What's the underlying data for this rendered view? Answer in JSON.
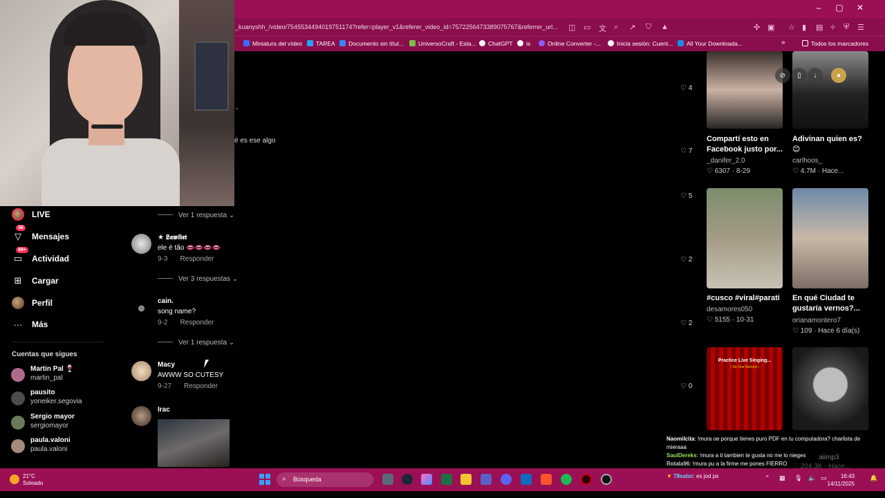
{
  "browser": {
    "url": "_kuanyshh_/video/7545534494019751174?refer=player_v1&referer_video_id=7572256473389075767&referrer_url...",
    "window_controls": [
      "–",
      "▢",
      "✕"
    ],
    "bookmarks": [
      {
        "label": "Miniatura del vídeo",
        "color": "#3b6cff"
      },
      {
        "label": "TAREA",
        "color": "#2ca0ff"
      },
      {
        "label": "Documento sin títul...",
        "color": "#3b82f6"
      },
      {
        "label": "UniversoCraft - Esta...",
        "color": "#7bc043"
      },
      {
        "label": "ChatGPT",
        "color": "#ffffff"
      },
      {
        "label": "is",
        "color": "#ffffff"
      },
      {
        "label": "Online Converter -...",
        "color": "#8b5cf6"
      },
      {
        "label": "Inicia sesión: Cuent...",
        "color": "#ffffff"
      },
      {
        "label": "All Your Downloada...",
        "color": "#1e88e5"
      }
    ],
    "bookmarks_more": "»",
    "all_bookmarks": "Todos los marcadores"
  },
  "nav": [
    {
      "label": "LIVE",
      "icon": "live-avatar-icon",
      "badge": ""
    },
    {
      "label": "Mensajes",
      "icon": "send-icon",
      "badge": "36"
    },
    {
      "label": "Actividad",
      "icon": "inbox-icon",
      "badge": "99+"
    },
    {
      "label": "Cargar",
      "icon": "plus-square-icon",
      "badge": ""
    },
    {
      "label": "Perfil",
      "icon": "profile-avatar-icon",
      "badge": ""
    },
    {
      "label": "Más",
      "icon": "more-icon",
      "badge": ""
    }
  ],
  "following": {
    "title": "Cuentas que sigues",
    "accounts": [
      {
        "name": "Martin Pal 🍷",
        "user": "martin_pal",
        "color": "#b06a8c"
      },
      {
        "name": "pausito",
        "user": "yoneiker.segovia",
        "color": "#4c4c4c"
      },
      {
        "name": "Sergio mayor",
        "user": "sergiomayor",
        "color": "#6b7a5a"
      },
      {
        "name": "paula.valoni",
        "user": "paula.valoni",
        "color": "#a58b7d"
      }
    ]
  },
  "comments": {
    "partial_text": "é es ese algo",
    "replies": [
      "Ver 1 respuesta",
      "Ver 3 respuestas",
      "Ver 1 respuesta"
    ],
    "items": [
      {
        "user": "★ 𝕷𝖆𝖜𝖑𝖎𝖊𝖙",
        "text": "ele é tão 👄👄👄👄",
        "date": "9-3",
        "reply": "Responder",
        "avatar_color": "#cfcfcf"
      },
      {
        "user": "cain.",
        "text": "song name?",
        "date": "9-2",
        "reply": "Responder",
        "avatar_color": "#222222"
      },
      {
        "user": "Macy",
        "text": "AWWW SO CUTESY",
        "date": "9-27",
        "reply": "Responder",
        "avatar_color": "#d7c2a8"
      },
      {
        "user": "Irac",
        "text": "",
        "date": "",
        "reply": "",
        "avatar_color": "#8c7766"
      }
    ]
  },
  "likes": [
    "4",
    "7",
    "5",
    "2",
    "2",
    "0"
  ],
  "videos": [
    {
      "title": "Compartí esto en Facebook justo por...",
      "author": "_danifer_2.0",
      "stats": "♡ 6307 · 8-29"
    },
    {
      "title": "Adivinan quien es? 😊",
      "author": "carlhoos_",
      "stats": "♡ 4.7M · Hace..."
    },
    {
      "title": "#cusco #viral#parati",
      "author": "desamores050",
      "stats": "♡ 5155 · 10-31"
    },
    {
      "title": "En qué Ciudad te gustaría vernos?...",
      "author": "orianamontero7",
      "stats": "♡ 109 · Hace 6 día(s)"
    },
    {
      "title": "",
      "author": "",
      "stats": "",
      "overlay_title": "Practice Live Singing...",
      "overlay_sub": "( No One Noticed )"
    },
    {
      "title": "",
      "author": "aiimp3",
      "stats": "♡ 204.3K · Hace..."
    }
  ],
  "chat": [
    {
      "user": "Naomilcita",
      "text": ": !mura oe porque tienes puro PDF en tu computadora? charlista de mieraaa",
      "color": "#ffffff"
    },
    {
      "user": "SaulDereks",
      "text": ": !mura a ti tambien te gusta no me lo nieges",
      "color": "#9be15d"
    },
    {
      "user": "Rotala96",
      "text": ": !mura pu a la firme me pones FIERRO",
      "color": "#cccccc"
    },
    {
      "user": "78eator",
      "text": ": es jod ps",
      "color": "#6ad2ff"
    }
  ],
  "taskbar": {
    "temp": "21°C",
    "weather": "Soleado",
    "search": "Búsqueda",
    "time": "16:43",
    "date": "14/11/2025"
  }
}
